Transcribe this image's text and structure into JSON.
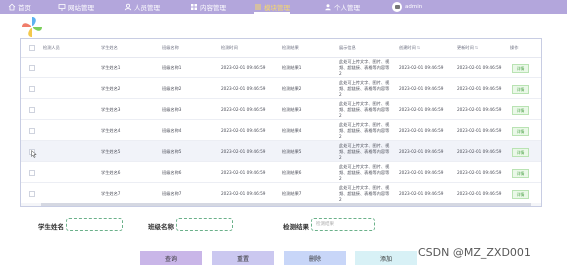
{
  "colors": {
    "topbar": "#b3a6dc",
    "active_nav": "#f6d86a",
    "search_button": "#c9b6e8",
    "reset_button": "#cbc8f0",
    "delete_button": "#c8d6f8",
    "add_button": "#d8f1f6",
    "status_tag": "#4ea34a"
  },
  "nav": {
    "items": [
      {
        "label": "首页",
        "icon": "home-icon"
      },
      {
        "label": "网站管理",
        "icon": "monitor-icon"
      },
      {
        "label": "人员管理",
        "icon": "user-icon"
      },
      {
        "label": "内容管理",
        "icon": "grid-icon"
      },
      {
        "label": "模块管理",
        "icon": "module-icon",
        "active": true
      },
      {
        "label": "个人管理",
        "icon": "person-icon"
      }
    ],
    "user": {
      "name": "admin",
      "icon": "avatar-icon"
    }
  },
  "table": {
    "headers": [
      "检测人员",
      "学生姓名",
      "班级名称",
      "检测时间",
      "检测结果",
      "展示信息",
      "创建时间",
      "更新时间",
      "操作"
    ],
    "rows": [
      {
        "student": "学生姓名1",
        "class": "班级名称1",
        "test_time": "2023-02-01 09:46:59",
        "result": "检测结果1",
        "info": "此处可上传文字、图片、视频、超链接、表格等内容等2",
        "created": "2023-02-01 09:46:59",
        "updated": "2023-02-01 09:46:59",
        "action": "详情"
      },
      {
        "student": "学生姓名2",
        "class": "班级名称2",
        "test_time": "2023-02-01 09:46:59",
        "result": "检测结果2",
        "info": "此处可上传文字、图片、视频、超链接、表格等内容等2",
        "created": "2023-02-01 09:46:59",
        "updated": "2023-02-01 09:46:59",
        "action": "详情"
      },
      {
        "student": "学生姓名3",
        "class": "班级名称3",
        "test_time": "2023-02-01 09:46:59",
        "result": "检测结果3",
        "info": "此处可上传文字、图片、视频、超链接、表格等内容等2",
        "created": "2023-02-01 09:46:59",
        "updated": "2023-02-01 09:46:59",
        "action": "详情"
      },
      {
        "student": "学生姓名4",
        "class": "班级名称4",
        "test_time": "2023-02-01 09:46:59",
        "result": "检测结果4",
        "info": "此处可上传文字、图片、视频、超链接、表格等内容等2",
        "created": "2023-02-01 09:46:59",
        "updated": "2023-02-01 09:46:59",
        "action": "详情"
      },
      {
        "student": "学生姓名5",
        "class": "班级名称5",
        "test_time": "2023-02-01 09:46:59",
        "result": "检测结果5",
        "info": "此处可上传文字、图片、视频、超链接、表格等内容等2",
        "created": "2023-02-01 09:46:59",
        "updated": "2023-02-01 09:46:59",
        "action": "详情"
      },
      {
        "student": "学生姓名6",
        "class": "班级名称6",
        "test_time": "2023-02-01 09:46:59",
        "result": "检测结果6",
        "info": "此处可上传文字、图片、视频、超链接、表格等内容等2",
        "created": "2023-02-01 09:46:59",
        "updated": "2023-02-01 09:46:59",
        "action": "详情"
      },
      {
        "student": "学生姓名7",
        "class": "班级名称7",
        "test_time": "2023-02-01 09:46:59",
        "result": "检测结果7",
        "info": "此处可上传文字、图片、视频、超链接、表格等内容等2",
        "created": "2023-02-01 09:46:59",
        "updated": "2023-02-01 09:46:59",
        "action": "详情"
      }
    ]
  },
  "search": {
    "student_label": "学生姓名",
    "class_label": "班级名称",
    "result_label": "检测结果",
    "result_placeholder": "检测结果"
  },
  "buttons": {
    "search": "查询",
    "reset": "重置",
    "delete": "删除",
    "add": "添加"
  },
  "watermark": "CSDN @MZ_ZXD001"
}
